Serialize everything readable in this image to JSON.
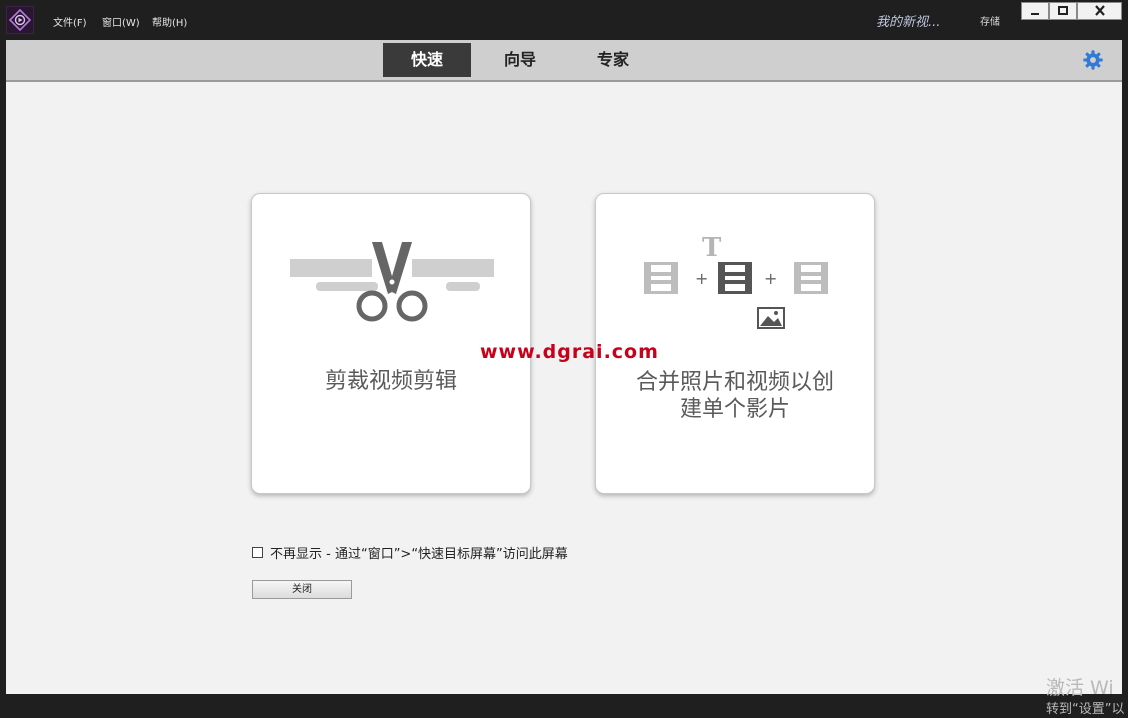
{
  "titlebar": {
    "menus": [
      "文件(F)",
      "窗口(W)",
      "帮助(H)"
    ],
    "project_name": "我的新视...",
    "save_label": "存储"
  },
  "mode_tabs": [
    {
      "label": "快速",
      "active": true
    },
    {
      "label": "向导",
      "active": false
    },
    {
      "label": "专家",
      "active": false
    }
  ],
  "cards": {
    "trim": {
      "label": "剪裁视频剪辑",
      "icon": "scissors-icon"
    },
    "merge": {
      "label_line1": "合并照片和视频以创",
      "label_line2": "建单个影片",
      "icon": "film-merge-icon"
    }
  },
  "watermark": "www.dgrai.com",
  "dont_show": "不再显示 - 通过“窗口”>“快速目标屏幕”访问此屏幕",
  "close_label": "关闭",
  "activation": {
    "line1": "激活 Wi",
    "line2": "转到“设置”以"
  },
  "colors": {
    "active_tab": "#3a3a3a",
    "watermark": "#c8001a",
    "gear": "#2f7bd6"
  }
}
